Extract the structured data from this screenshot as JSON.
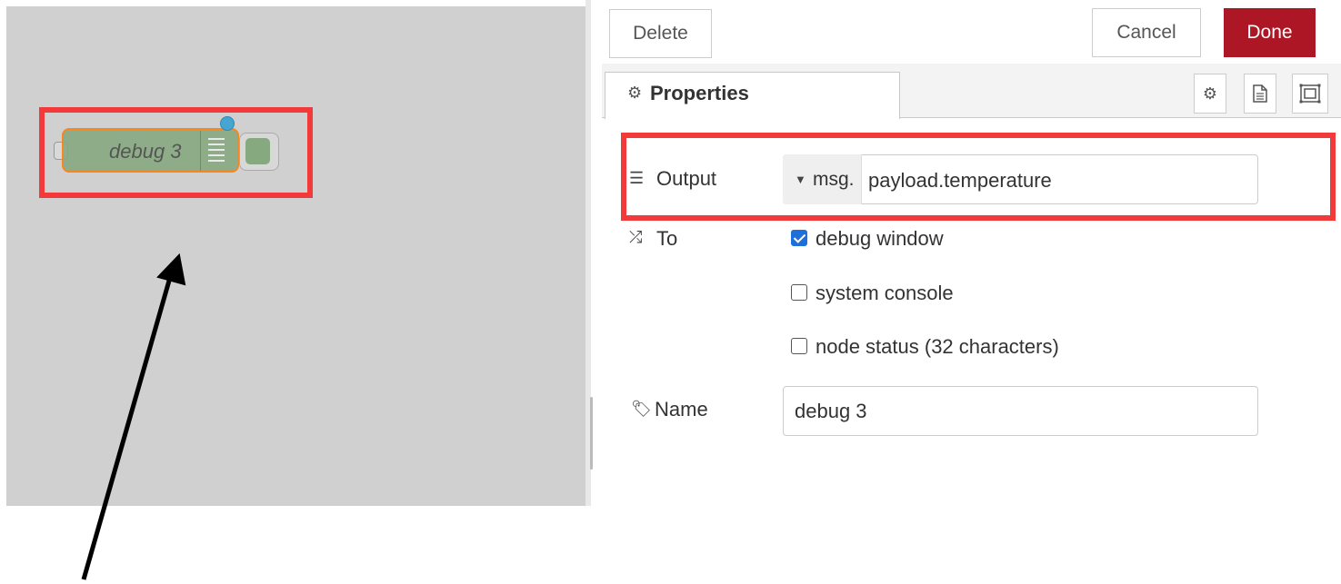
{
  "canvas": {
    "node": {
      "label": "debug 3",
      "icon": "list-icon",
      "fill": "#87a980",
      "changed_color": "#47a6d1"
    }
  },
  "toolbar": {
    "delete_label": "Delete",
    "cancel_label": "Cancel",
    "done_label": "Done",
    "done_color": "#ad1625"
  },
  "tabs": {
    "properties_label": "Properties",
    "properties_icon": "gear-icon",
    "side_buttons": [
      "settings-icon",
      "description-icon",
      "appearance-icon"
    ]
  },
  "form": {
    "output": {
      "label": "Output",
      "icon": "list-icon",
      "type_prefix": "msg.",
      "value": "payload.temperature"
    },
    "to": {
      "label": "To",
      "icon": "shuffle-icon",
      "options": [
        {
          "label": "debug window",
          "checked": true
        },
        {
          "label": "system console",
          "checked": false
        },
        {
          "label": "node status (32 characters)",
          "checked": false
        }
      ]
    },
    "name": {
      "label": "Name",
      "icon": "tag-icon",
      "value": "debug 3"
    }
  },
  "annotations": {
    "highlight_color": "#f23a3a",
    "arrow_color": "#000000"
  }
}
